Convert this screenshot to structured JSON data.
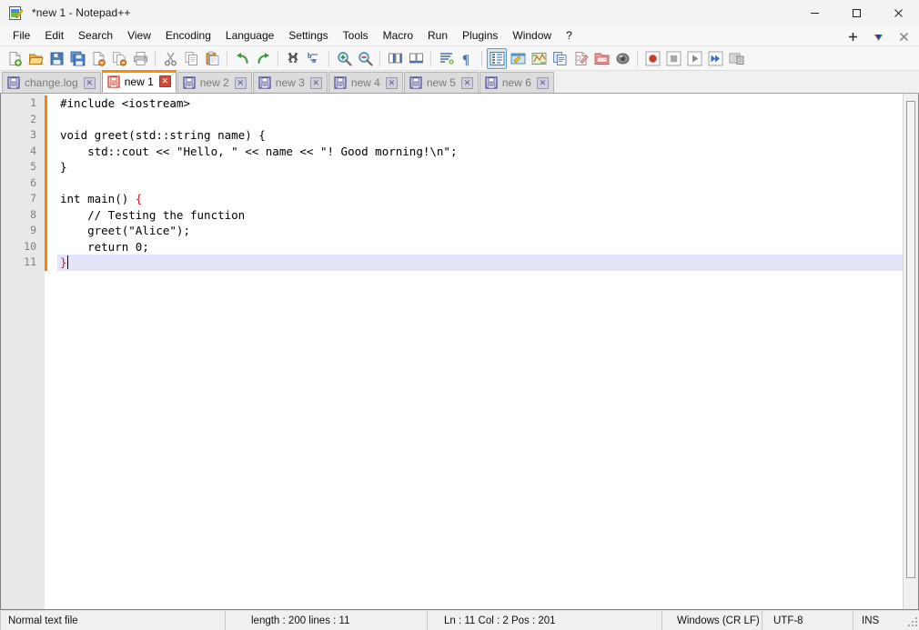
{
  "window": {
    "title": "*new 1 - Notepad++",
    "app_icon": "notepad-plus-plus-icon",
    "controls": {
      "minimize": "—",
      "maximize": "☐",
      "close": "✕"
    }
  },
  "menubar": {
    "items": [
      {
        "label": "File",
        "name": "menu-file"
      },
      {
        "label": "Edit",
        "name": "menu-edit"
      },
      {
        "label": "Search",
        "name": "menu-search"
      },
      {
        "label": "View",
        "name": "menu-view"
      },
      {
        "label": "Encoding",
        "name": "menu-encoding"
      },
      {
        "label": "Language",
        "name": "menu-language"
      },
      {
        "label": "Settings",
        "name": "menu-settings"
      },
      {
        "label": "Tools",
        "name": "menu-tools"
      },
      {
        "label": "Macro",
        "name": "menu-macro"
      },
      {
        "label": "Run",
        "name": "menu-run"
      },
      {
        "label": "Plugins",
        "name": "menu-plugins"
      },
      {
        "label": "Window",
        "name": "menu-window"
      },
      {
        "label": "?",
        "name": "menu-help"
      }
    ],
    "right_buttons": [
      {
        "name": "new-tab-plus-icon",
        "glyph": "+"
      },
      {
        "name": "tab-list-dropdown-icon",
        "glyph": "▼"
      },
      {
        "name": "close-tab-x-icon",
        "glyph": "✕"
      }
    ]
  },
  "toolbar": {
    "buttons": [
      {
        "name": "new-file-icon",
        "title": "New"
      },
      {
        "name": "open-file-icon",
        "title": "Open"
      },
      {
        "name": "save-icon",
        "title": "Save"
      },
      {
        "name": "save-all-icon",
        "title": "Save All"
      },
      {
        "name": "close-file-icon",
        "title": "Close"
      },
      {
        "name": "close-all-files-icon",
        "title": "Close All"
      },
      {
        "name": "print-icon",
        "title": "Print"
      },
      {
        "name": "cut-icon",
        "title": "Cut"
      },
      {
        "name": "copy-icon",
        "title": "Copy"
      },
      {
        "name": "paste-icon",
        "title": "Paste"
      },
      {
        "name": "undo-icon",
        "title": "Undo"
      },
      {
        "name": "redo-icon",
        "title": "Redo"
      },
      {
        "name": "find-icon",
        "title": "Find"
      },
      {
        "name": "replace-icon",
        "title": "Replace"
      },
      {
        "name": "zoom-in-icon",
        "title": "Zoom In"
      },
      {
        "name": "zoom-out-icon",
        "title": "Zoom Out"
      },
      {
        "name": "sync-vertical-scroll-icon",
        "title": "Sync Vertical Scrolling"
      },
      {
        "name": "sync-horizontal-scroll-icon",
        "title": "Sync Horizontal Scrolling"
      },
      {
        "name": "word-wrap-icon",
        "title": "Word Wrap"
      },
      {
        "name": "show-all-characters-icon",
        "title": "Show All Characters"
      },
      {
        "name": "show-indent-guide-icon",
        "title": "Show Indent Guide",
        "active": true
      },
      {
        "name": "user-defined-dialog-icon",
        "title": "UserDefine Dialog"
      },
      {
        "name": "document-map-icon",
        "title": "Document Map"
      },
      {
        "name": "function-list-icon",
        "title": "Function List"
      },
      {
        "name": "document-switcher-icon",
        "title": "Document Switcher"
      },
      {
        "name": "folder-as-workspace-icon",
        "title": "Folder as Workspace"
      },
      {
        "name": "monitoring-icon",
        "title": "Monitoring"
      },
      {
        "name": "macro-record-icon",
        "title": "Start Recording"
      },
      {
        "name": "macro-stop-icon",
        "title": "Stop Recording"
      },
      {
        "name": "macro-play-icon",
        "title": "Playback"
      },
      {
        "name": "macro-run-multiple-icon",
        "title": "Run a Macro Multiple Times"
      },
      {
        "name": "macro-save-icon",
        "title": "Save Current Recorded Macro"
      }
    ]
  },
  "tabs": [
    {
      "label": "change.log",
      "active": false,
      "modified": false,
      "close": "✕"
    },
    {
      "label": "new 1",
      "active": true,
      "modified": true,
      "close": "✕"
    },
    {
      "label": "new 2",
      "active": false,
      "modified": false,
      "close": "✕"
    },
    {
      "label": "new 3",
      "active": false,
      "modified": false,
      "close": "✕"
    },
    {
      "label": "new 4",
      "active": false,
      "modified": false,
      "close": "✕"
    },
    {
      "label": "new 5",
      "active": false,
      "modified": false,
      "close": "✕"
    },
    {
      "label": "new 6",
      "active": false,
      "modified": false,
      "close": "✕"
    }
  ],
  "editor": {
    "line_numbers": [
      1,
      2,
      3,
      4,
      5,
      6,
      7,
      8,
      9,
      10,
      11
    ],
    "current_line": 11,
    "lines": [
      {
        "n": 1,
        "text": "#include <iostream>"
      },
      {
        "n": 2,
        "text": ""
      },
      {
        "n": 3,
        "text": "void greet(std::string name) {"
      },
      {
        "n": 4,
        "text": "    std::cout << \"Hello, \" << name << \"! Good morning!\\n\";"
      },
      {
        "n": 5,
        "text": "}"
      },
      {
        "n": 6,
        "text": ""
      },
      {
        "n": 7,
        "text": "int main() ",
        "brace": "{"
      },
      {
        "n": 8,
        "text": "    // Testing the function"
      },
      {
        "n": 9,
        "text": "    greet(\"Alice\");"
      },
      {
        "n": 10,
        "text": "    return 0;"
      },
      {
        "n": 11,
        "text": "",
        "brace": "}"
      }
    ],
    "change_marker_color": "#ff8000",
    "current_line_color": "#e4e4f7",
    "brace_match_color": "#cc2222"
  },
  "statusbar": {
    "doc_type": "Normal text file",
    "length_lines": "length : 200   lines : 11",
    "position": "Ln : 11    Col : 2    Pos : 201",
    "eol": "Windows (CR LF)",
    "encoding": "UTF-8",
    "insert_mode": "INS"
  }
}
